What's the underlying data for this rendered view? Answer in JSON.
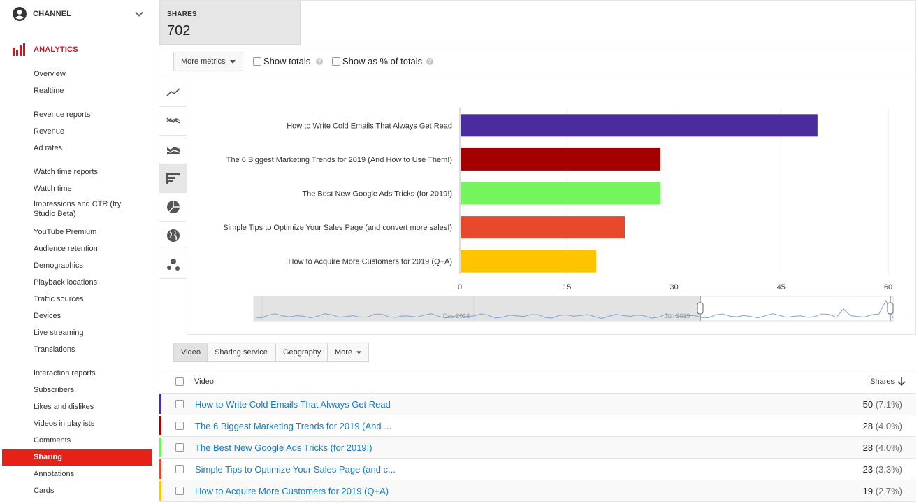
{
  "sidebar": {
    "channel_label": "CHANNEL",
    "analytics_label": "ANALYTICS",
    "items": [
      {
        "label": "Overview"
      },
      {
        "label": "Realtime"
      },
      {
        "label": "Revenue reports"
      },
      {
        "label": "Revenue"
      },
      {
        "label": "Ad rates"
      },
      {
        "label": "Watch time reports"
      },
      {
        "label": "Watch time"
      },
      {
        "label": "Impressions and CTR (try Studio Beta)"
      },
      {
        "label": "YouTube Premium"
      },
      {
        "label": "Audience retention"
      },
      {
        "label": "Demographics"
      },
      {
        "label": "Playback locations"
      },
      {
        "label": "Traffic sources"
      },
      {
        "label": "Devices"
      },
      {
        "label": "Live streaming"
      },
      {
        "label": "Translations"
      },
      {
        "label": "Interaction reports"
      },
      {
        "label": "Subscribers"
      },
      {
        "label": "Likes and dislikes"
      },
      {
        "label": "Videos in playlists"
      },
      {
        "label": "Comments"
      },
      {
        "label": "Sharing"
      },
      {
        "label": "Annotations"
      },
      {
        "label": "Cards"
      }
    ],
    "active_item": "Sharing"
  },
  "metric": {
    "title": "SHARES",
    "value": "702"
  },
  "controls": {
    "more_metrics": "More metrics",
    "show_totals": "Show totals",
    "show_percent": "Show as % of totals"
  },
  "chart_types": [
    "line-chart-icon",
    "multi-line-chart-icon",
    "stacked-area-chart-icon",
    "bar-chart-icon",
    "pie-chart-icon",
    "globe-map-icon",
    "bubble-chart-icon"
  ],
  "chart_data": {
    "type": "bar",
    "orientation": "horizontal",
    "categories": [
      "How to Write Cold Emails That Always Get Read",
      "The 6 Biggest Marketing Trends for 2019 (And How to Use Them!)",
      "The Best New Google Ads Tricks (for 2019!)",
      "Simple Tips to Optimize Your Sales Page (and convert more sales!)",
      "How to Acquire More Customers for 2019 (Q+A)"
    ],
    "values": [
      50,
      28,
      28,
      23,
      19
    ],
    "colors": [
      "#4b2c9e",
      "#a50000",
      "#74f55c",
      "#e8482b",
      "#ffc400"
    ],
    "xticks": [
      "0",
      "15",
      "30",
      "45",
      "60"
    ],
    "xlim": [
      0,
      60
    ],
    "timeline_labels": [
      "Dec 2018",
      "Jan 2019"
    ]
  },
  "tabs": [
    "Video",
    "Sharing service",
    "Geography",
    "More"
  ],
  "table": {
    "col_video": "Video",
    "col_shares": "Shares",
    "rows": [
      {
        "title": "How to Write Cold Emails That Always Get Read",
        "value": "50",
        "pct": "(7.1%)",
        "color": "#4b2c9e"
      },
      {
        "title": "The 6 Biggest Marketing Trends for 2019 (And ...",
        "value": "28",
        "pct": "(4.0%)",
        "color": "#a50000"
      },
      {
        "title": "The Best New Google Ads Tricks (for 2019!)",
        "value": "28",
        "pct": "(4.0%)",
        "color": "#74f55c"
      },
      {
        "title": "Simple Tips to Optimize Your Sales Page (and c...",
        "value": "23",
        "pct": "(3.3%)",
        "color": "#e8482b"
      },
      {
        "title": "How to Acquire More Customers for 2019 (Q+A)",
        "value": "19",
        "pct": "(2.7%)",
        "color": "#ffc400"
      }
    ]
  }
}
